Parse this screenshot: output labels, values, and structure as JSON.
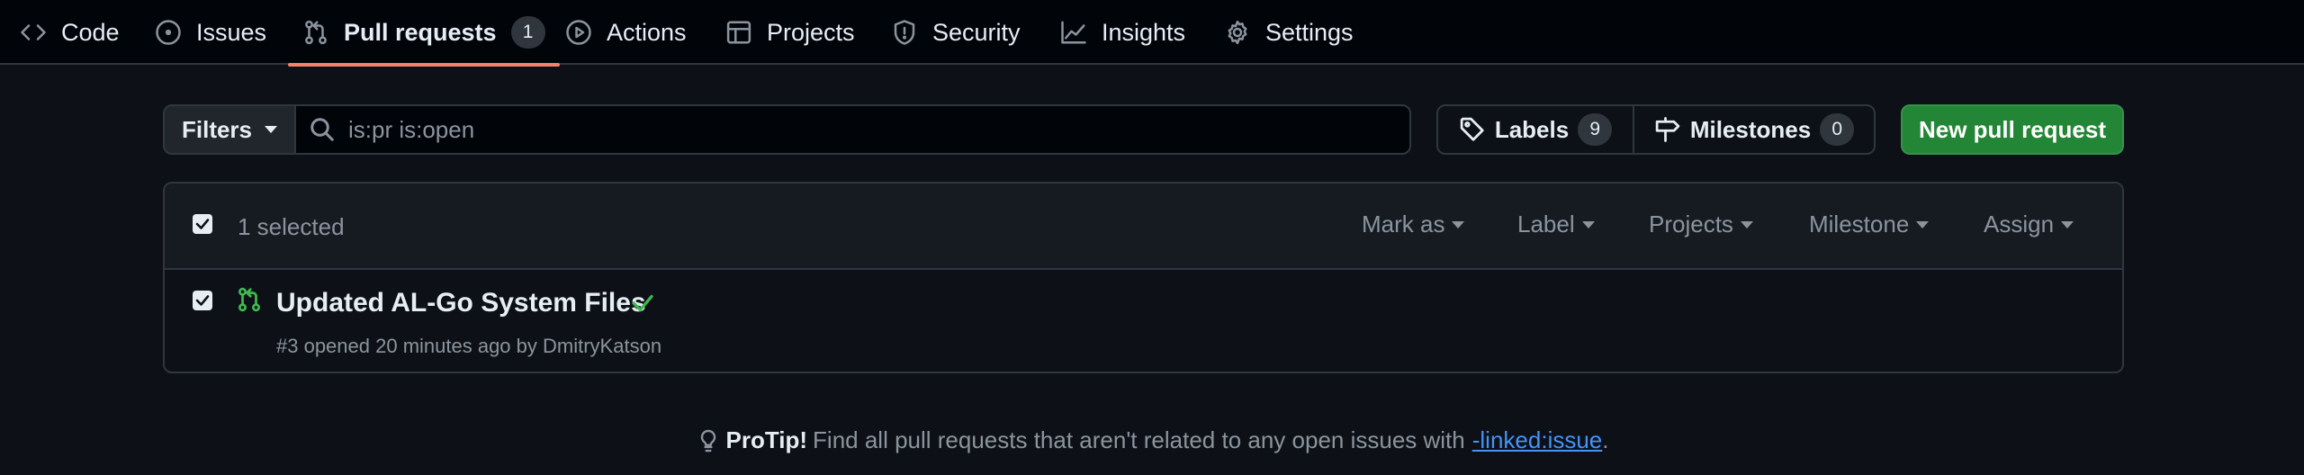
{
  "nav": {
    "tabs": [
      {
        "label": "Code",
        "icon": "code-icon"
      },
      {
        "label": "Issues",
        "icon": "issue-icon"
      },
      {
        "label": "Pull requests",
        "icon": "pull-request-icon",
        "count": "1",
        "active": true
      },
      {
        "label": "Actions",
        "icon": "play-icon"
      },
      {
        "label": "Projects",
        "icon": "table-icon"
      },
      {
        "label": "Security",
        "icon": "shield-icon"
      },
      {
        "label": "Insights",
        "icon": "graph-icon"
      },
      {
        "label": "Settings",
        "icon": "gear-icon"
      }
    ],
    "active_color": "#f78166"
  },
  "toolbar": {
    "filters_label": "Filters",
    "search_value": "is:pr is:open",
    "labels_label": "Labels",
    "labels_count": "9",
    "milestones_label": "Milestones",
    "milestones_count": "0",
    "new_pr_label": "New pull request",
    "new_pr_color": "#238636"
  },
  "list": {
    "selected_text": "1 selected",
    "header_menus": [
      "Mark as",
      "Label",
      "Projects",
      "Milestone",
      "Assign"
    ],
    "items": [
      {
        "title": "Updated AL-Go System Files",
        "status": "check-icon",
        "meta_prefix": "#3 opened 20 minutes ago by ",
        "author": "DmitryKatson",
        "checked": true
      }
    ]
  },
  "protip": {
    "label": "ProTip!",
    "text": "Find all pull requests that aren't related to any open issues with",
    "link": "-linked:issue",
    "suffix": "."
  }
}
